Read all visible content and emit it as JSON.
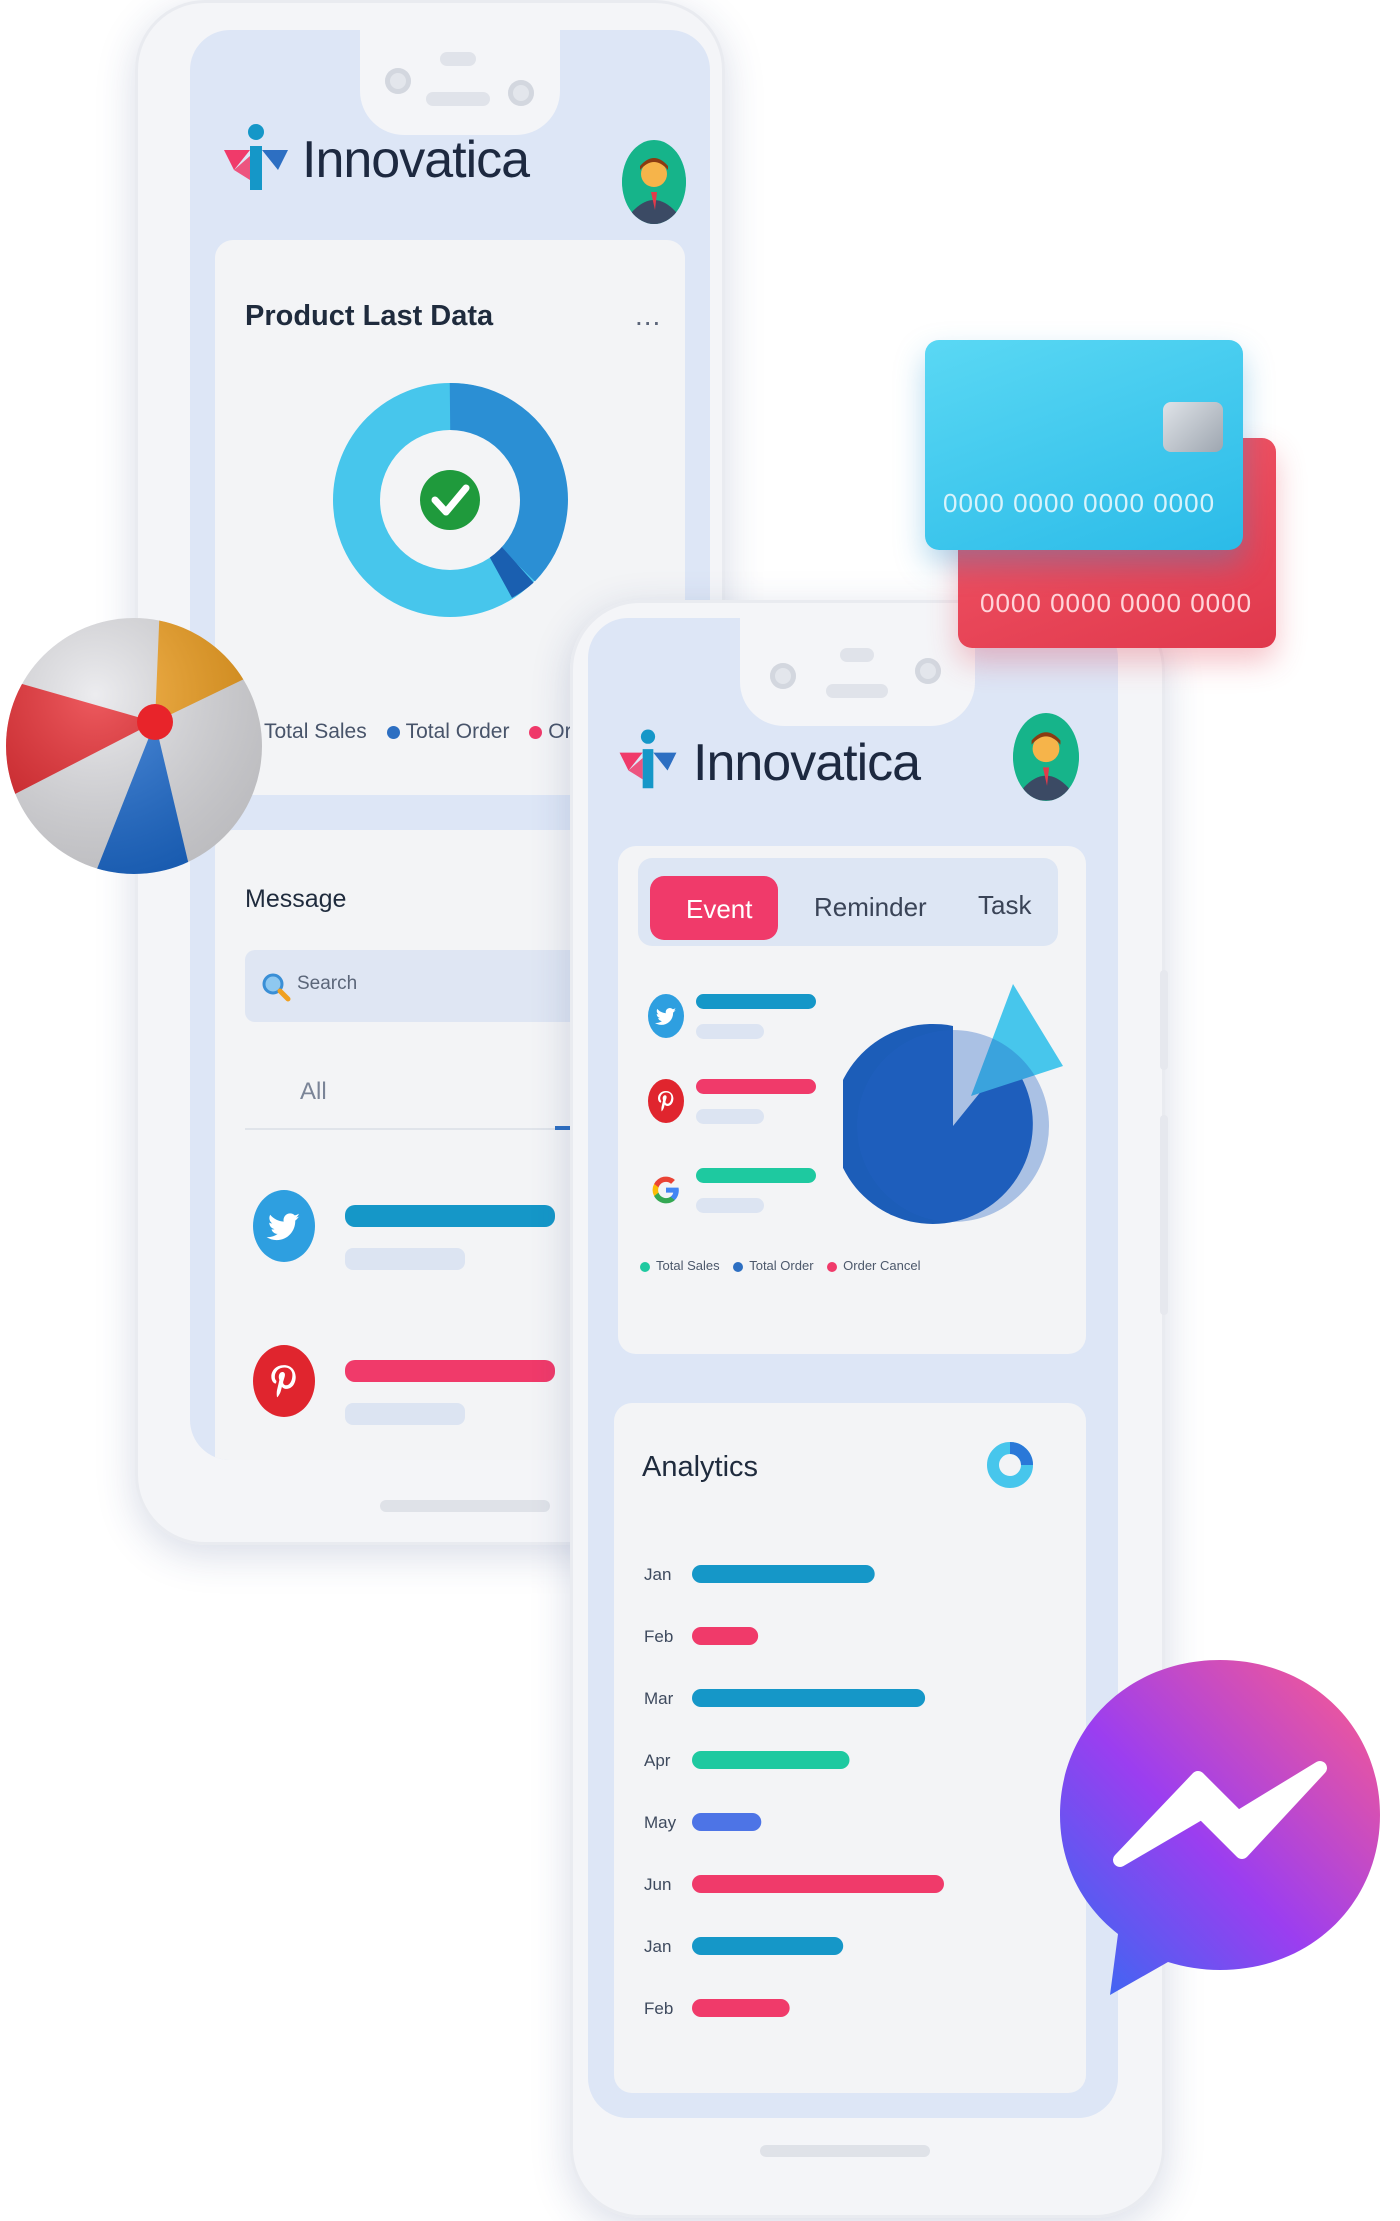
{
  "app": {
    "brand": "Innovatica"
  },
  "back_phone": {
    "product_card": {
      "title": "Product Last Data",
      "menu": "...",
      "legend": [
        "Total Sales",
        "Total Order",
        "Or"
      ]
    },
    "message_card": {
      "title": "Message",
      "search_placeholder": "Search",
      "tab_all": "All"
    }
  },
  "front_phone": {
    "tabs": [
      "Event",
      "Reminder",
      "Task"
    ],
    "legend": [
      "Total Sales",
      "Total Order",
      "Order Cancel"
    ],
    "analytics": {
      "title": "Analytics"
    }
  },
  "cards": {
    "blue_number": "0000 0000 0000 0000",
    "red_number": "0000 0000 0000 0000"
  },
  "colors": {
    "blue": "#1597c8",
    "pink": "#f03a6a",
    "green": "#1ec9a0",
    "indigo": "#4d74e6",
    "dark_blue": "#2d6fc2"
  },
  "icons": [
    "twitter-icon",
    "pinterest-icon",
    "google-icon",
    "search-icon",
    "check-icon",
    "messenger-icon",
    "beach-ball-icon",
    "credit-card-icon",
    "avatar-icon"
  ],
  "chart_data": {
    "type": "bar",
    "categories": [
      "Jan",
      "Feb",
      "Mar",
      "Apr",
      "May",
      "Jun",
      "Jan",
      "Feb"
    ],
    "values": [
      58,
      21,
      74,
      50,
      22,
      80,
      48,
      31
    ],
    "colors": [
      "#1597c8",
      "#f03a6a",
      "#1597c8",
      "#1ec9a0",
      "#4d74e6",
      "#f03a6a",
      "#1597c8",
      "#f03a6a"
    ],
    "title": "Analytics",
    "xlim": [
      0,
      100
    ]
  }
}
